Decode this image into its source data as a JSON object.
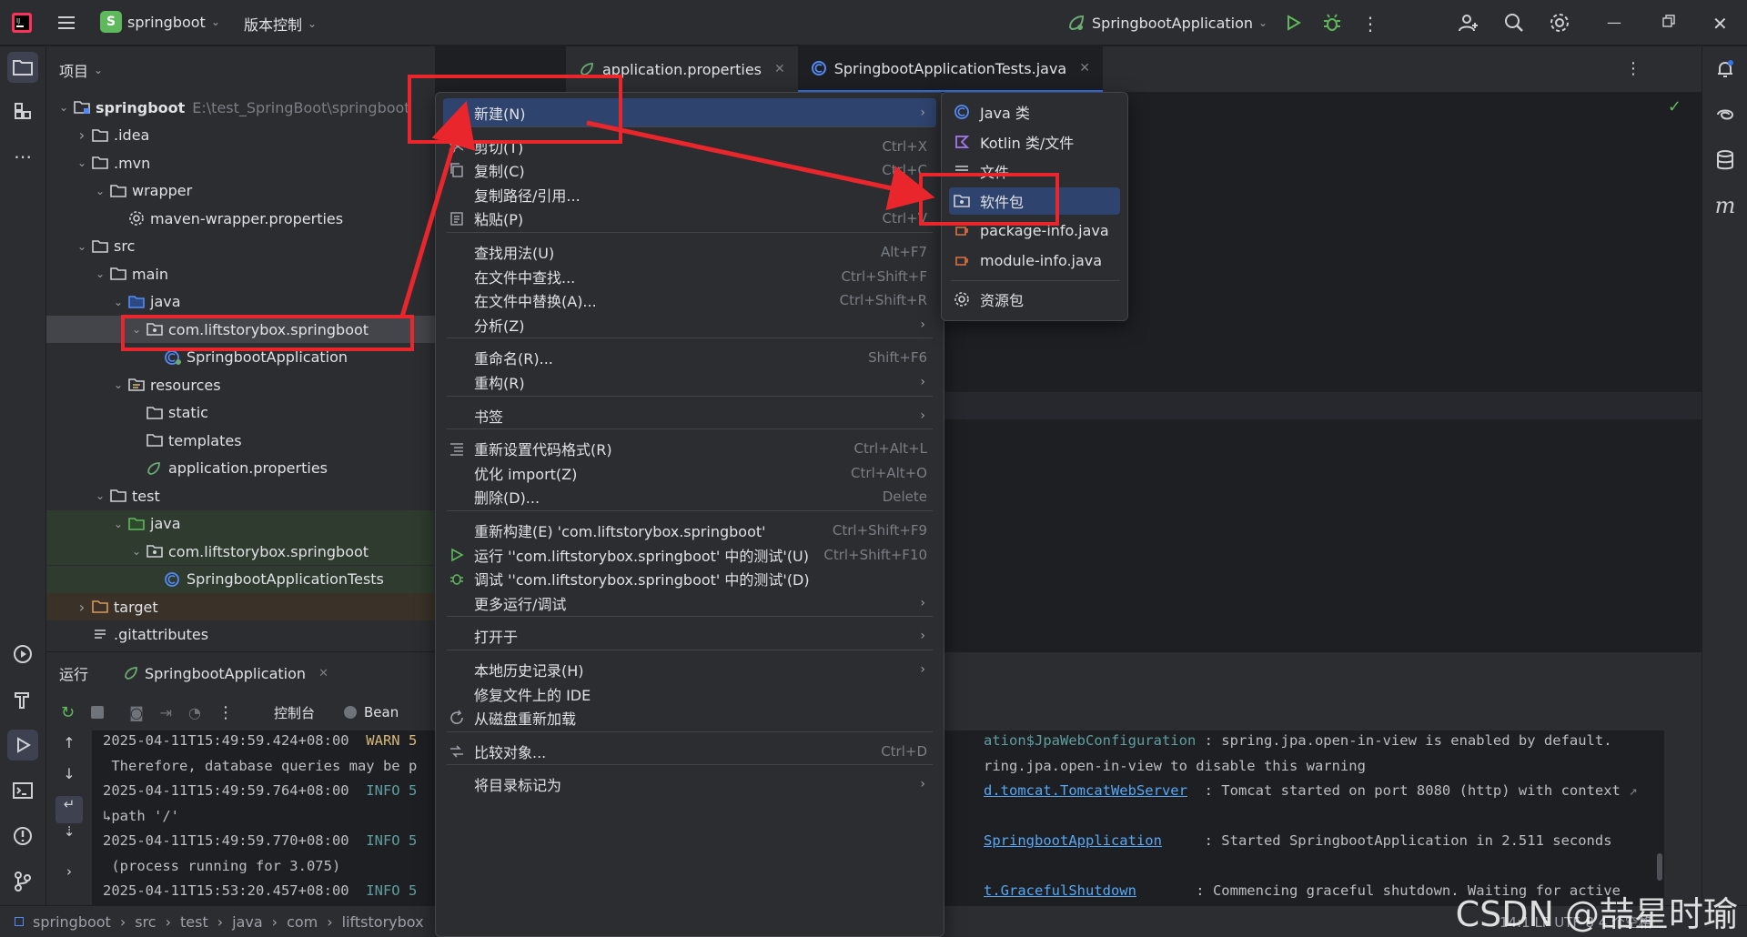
{
  "topbar": {
    "project_initial": "S",
    "project_name": "springboot",
    "vcs_label": "版本控制",
    "run_config": "SpringbootApplication"
  },
  "project_panel": {
    "title": "项目",
    "tree": [
      {
        "label": "springboot",
        "path": "E:\\test_SpringBoot\\springboot",
        "icon": "folder-module-icon",
        "depth": 0,
        "expanded": true
      },
      {
        "label": ".idea",
        "icon": "folder-icon",
        "depth": 1,
        "expanded": false
      },
      {
        "label": ".mvn",
        "icon": "folder-icon",
        "depth": 1,
        "expanded": true
      },
      {
        "label": "wrapper",
        "icon": "folder-icon",
        "depth": 2,
        "expanded": true
      },
      {
        "label": "maven-wrapper.properties",
        "icon": "gear-icon",
        "depth": 3
      },
      {
        "label": "src",
        "icon": "folder-icon",
        "depth": 1,
        "expanded": true
      },
      {
        "label": "main",
        "icon": "folder-icon",
        "depth": 2,
        "expanded": true
      },
      {
        "label": "java",
        "icon": "source-folder-icon",
        "depth": 3,
        "expanded": true
      },
      {
        "label": "com.liftstorybox.springboot",
        "icon": "package-icon",
        "depth": 4,
        "expanded": true,
        "selected": true
      },
      {
        "label": "SpringbootApplication",
        "icon": "spring-class-icon",
        "depth": 5
      },
      {
        "label": "resources",
        "icon": "resources-folder-icon",
        "depth": 3,
        "expanded": true
      },
      {
        "label": "static",
        "icon": "folder-icon",
        "depth": 4
      },
      {
        "label": "templates",
        "icon": "folder-icon",
        "depth": 4
      },
      {
        "label": "application.properties",
        "icon": "spring-properties-icon",
        "depth": 4
      },
      {
        "label": "test",
        "icon": "folder-icon",
        "depth": 2,
        "expanded": true
      },
      {
        "label": "java",
        "icon": "test-folder-icon",
        "depth": 3,
        "expanded": true,
        "test": true
      },
      {
        "label": "com.liftstorybox.springboot",
        "icon": "package-icon",
        "depth": 4,
        "expanded": true,
        "test": true
      },
      {
        "label": "SpringbootApplicationTests",
        "icon": "test-class-icon",
        "depth": 5,
        "test": true
      },
      {
        "label": "target",
        "icon": "folder-excluded-icon",
        "depth": 1,
        "expanded": false,
        "target": true
      },
      {
        "label": ".gitattributes",
        "icon": "text-file-icon",
        "depth": 1
      }
    ]
  },
  "editor_tabs": [
    {
      "label": "application.properties",
      "active": false
    },
    {
      "label": "SpringbootApplicationTests.java",
      "active": true
    }
  ],
  "context_menu": {
    "items": [
      {
        "label": "新建(N)",
        "icon": "",
        "shortcut": "",
        "arrow": true,
        "highlight": true
      },
      {
        "sep": true
      },
      {
        "label": "剪切(T)",
        "icon": "scissors-icon",
        "shortcut": "Ctrl+X"
      },
      {
        "label": "复制(C)",
        "icon": "copy-icon",
        "shortcut": "Ctrl+C"
      },
      {
        "label": "复制路径/引用...",
        "icon": "",
        "shortcut": ""
      },
      {
        "label": "粘贴(P)",
        "icon": "paste-icon",
        "shortcut": "Ctrl+V"
      },
      {
        "sep": true
      },
      {
        "label": "查找用法(U)",
        "icon": "",
        "shortcut": "Alt+F7"
      },
      {
        "label": "在文件中查找...",
        "icon": "",
        "shortcut": "Ctrl+Shift+F"
      },
      {
        "label": "在文件中替换(A)...",
        "icon": "",
        "shortcut": "Ctrl+Shift+R"
      },
      {
        "label": "分析(Z)",
        "icon": "",
        "shortcut": "",
        "arrow": true
      },
      {
        "sep": true
      },
      {
        "label": "重命名(R)...",
        "icon": "",
        "shortcut": "Shift+F6"
      },
      {
        "label": "重构(R)",
        "icon": "",
        "shortcut": "",
        "arrow": true
      },
      {
        "sep": true
      },
      {
        "label": "书签",
        "icon": "",
        "shortcut": "",
        "arrow": true
      },
      {
        "sep": true
      },
      {
        "label": "重新设置代码格式(R)",
        "icon": "format-icon",
        "shortcut": "Ctrl+Alt+L"
      },
      {
        "label": "优化 import(Z)",
        "icon": "",
        "shortcut": "Ctrl+Alt+O"
      },
      {
        "label": "删除(D)...",
        "icon": "",
        "shortcut": "Delete"
      },
      {
        "sep": true
      },
      {
        "label": "重新构建(E) 'com.liftstorybox.springboot'",
        "icon": "",
        "shortcut": "Ctrl+Shift+F9"
      },
      {
        "label": "运行 ''com.liftstorybox.springboot' 中的测试'(U)",
        "icon": "run-icon",
        "shortcut": "Ctrl+Shift+F10"
      },
      {
        "label": "调试 ''com.liftstorybox.springboot' 中的测试'(D)",
        "icon": "debug-icon",
        "shortcut": ""
      },
      {
        "label": "更多运行/调试",
        "icon": "",
        "shortcut": "",
        "arrow": true
      },
      {
        "sep": true
      },
      {
        "label": "打开于",
        "icon": "",
        "shortcut": "",
        "arrow": true
      },
      {
        "sep": true
      },
      {
        "label": "本地历史记录(H)",
        "icon": "",
        "shortcut": "",
        "arrow": true
      },
      {
        "label": "修复文件上的 IDE",
        "icon": "",
        "shortcut": ""
      },
      {
        "label": "从磁盘重新加载",
        "icon": "reload-icon",
        "shortcut": ""
      },
      {
        "sep": true
      },
      {
        "label": "比较对象...",
        "icon": "compare-icon",
        "shortcut": "Ctrl+D"
      },
      {
        "sep": true
      },
      {
        "label": "将目录标记为",
        "icon": "",
        "shortcut": "",
        "arrow": true
      }
    ]
  },
  "sub_menu": {
    "items": [
      {
        "label": "Java 类",
        "icon": "java-class-icon"
      },
      {
        "label": "Kotlin 类/文件",
        "icon": "kotlin-icon"
      },
      {
        "label": "文件",
        "icon": "file-icon"
      },
      {
        "label": "软件包",
        "icon": "package-icon",
        "highlight": true
      },
      {
        "label": "package-info.java",
        "icon": "java-file-icon"
      },
      {
        "label": "module-info.java",
        "icon": "java-file-icon"
      },
      {
        "label": "资源包",
        "icon": "gear-icon",
        "sep_before": true
      }
    ]
  },
  "run_panel": {
    "title": "运行",
    "config_tab": "SpringbootApplication",
    "console_tab": "控制台",
    "bean_tab": "Bean",
    "lines": [
      {
        "time": "2025-04-11T15:49:59.424+08:00",
        "level": "WARN",
        "levelTail": "5",
        "text_a": "Therefore, database queries may be p",
        "link": "ation$JpaWebConfiguration",
        "msg": " : spring.jpa.open-in-view is enabled by default.",
        "cont": "ring.jpa.open-in-view to disable this warning"
      },
      {
        "time": "2025-04-11T15:49:59.764+08:00",
        "level": "INFO",
        "levelTail": "5",
        "link": "d.tomcat.TomcatWebServer",
        "msg": "  : Tomcat started on port 8080 (http) with context",
        "cont_prefix": "path '/'"
      },
      {
        "time": "2025-04-11T15:49:59.770+08:00",
        "level": "INFO",
        "levelTail": "5",
        "link": "SpringbootApplication",
        "msg": "     : Started SpringbootApplication in 2.511 seconds",
        "cont_prefix": "(process running for 3.075)"
      },
      {
        "time": "2025-04-11T15:53:20.457+08:00",
        "level": "INFO",
        "levelTail": "5",
        "link": "t.GracefulShutdown",
        "msg": "       : Commencing graceful shutdown. Waiting for active"
      }
    ]
  },
  "statusbar": {
    "breadcrumb": [
      "springboot",
      "src",
      "test",
      "java",
      "com",
      "liftstorybox"
    ],
    "right": "14:1   LF   UTF-8   4 个空格"
  },
  "watermark": "CSDN @喆星时瑜",
  "colors": {
    "accent": "#3574f0",
    "highlight": "#2e436e",
    "annotation_red": "#e8262b"
  }
}
